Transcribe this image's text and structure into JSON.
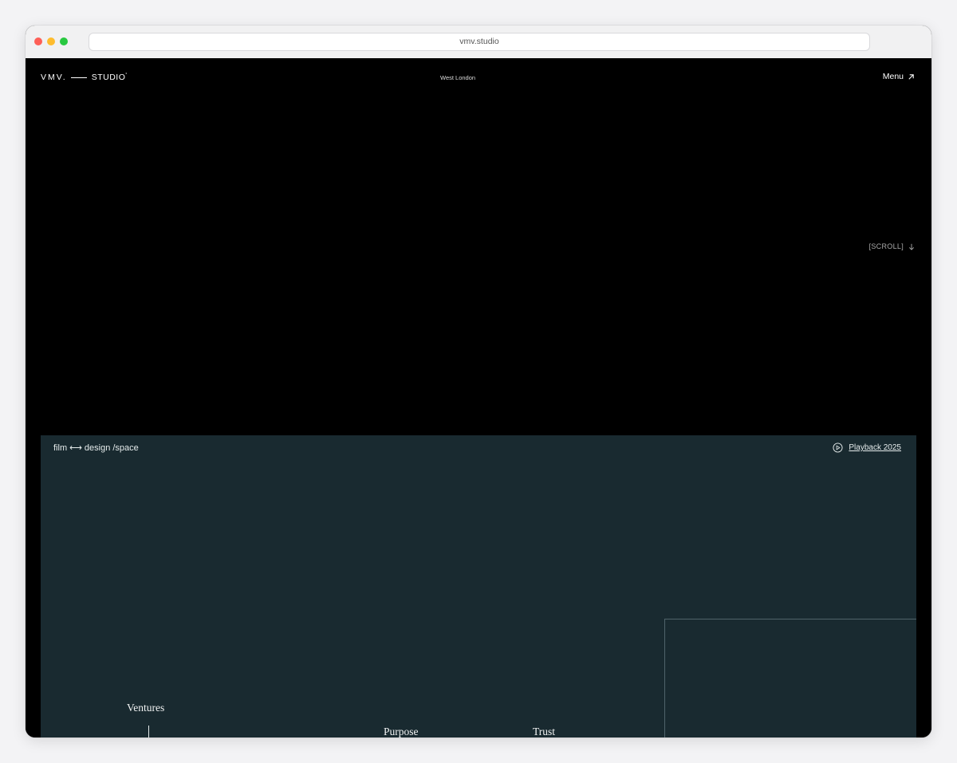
{
  "browser": {
    "url": "vmv.studio"
  },
  "header": {
    "logo_left": "VMV.",
    "logo_right": "STUDIO",
    "logo_mark": "°",
    "location": "West London",
    "menu_label": "Menu",
    "menu_icon": "arrow-up-right-icon"
  },
  "hero": {
    "scroll_label": "[SCROLL]",
    "scroll_icon": "arrow-down-icon"
  },
  "panel": {
    "tag_left": "film",
    "tag_arrow": "⟷",
    "tag_right": "design /space",
    "playback_label": "Playback 2025",
    "playback_icon": "play-circle-icon",
    "background": "#192a30",
    "words": {
      "ventures": "Ventures",
      "purpose": "Purpose",
      "trust": "Trust"
    }
  }
}
